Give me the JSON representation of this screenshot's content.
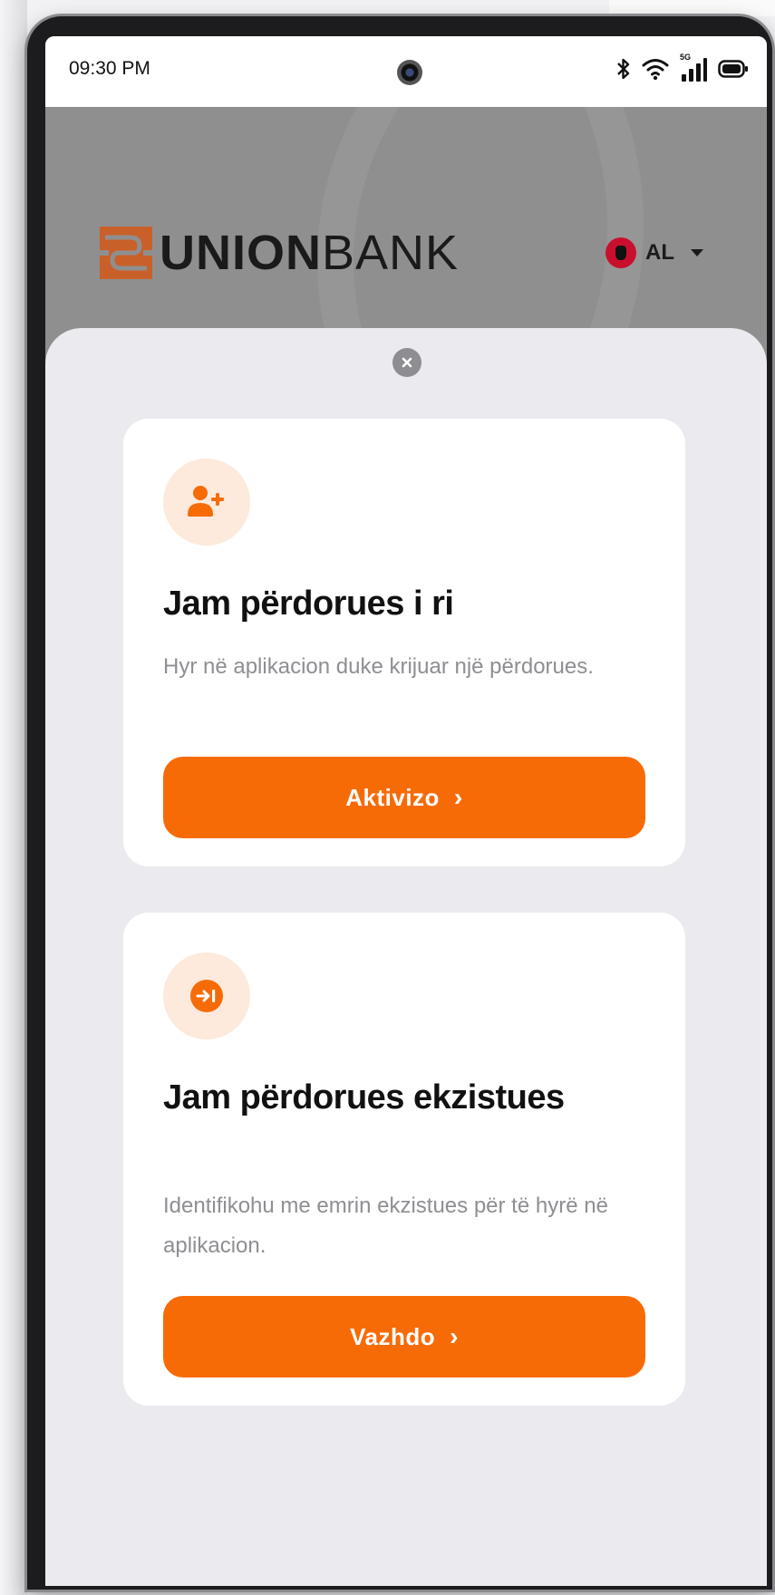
{
  "status_bar": {
    "time": "09:30 PM",
    "network": "5G",
    "icons": [
      "bluetooth-icon",
      "wifi-icon",
      "signal-icon",
      "battery-icon"
    ]
  },
  "header": {
    "brand_bold": "UNION",
    "brand_light": "BANK",
    "language": {
      "code": "AL",
      "flag": "albania-flag"
    }
  },
  "sheet": {
    "close_icon": "close-icon",
    "cards": [
      {
        "icon": "add-user-icon",
        "title": "Jam përdorues i ri",
        "description": "Hyr në aplikacion duke krijuar një përdorues.",
        "button_label": "Aktivizo",
        "button_chevron": "›"
      },
      {
        "icon": "login-icon",
        "title": "Jam përdorues ekzistues",
        "description": "Identifikohu me emrin ekzistues për të hyrë në aplikacion.",
        "button_label": "Vazhdo",
        "button_chevron": "›"
      }
    ]
  },
  "colors": {
    "accent": "#f76b07",
    "icon_bg": "#fdeadc",
    "sheet_bg": "#ebebef",
    "header_bg": "#8f8f8f"
  }
}
